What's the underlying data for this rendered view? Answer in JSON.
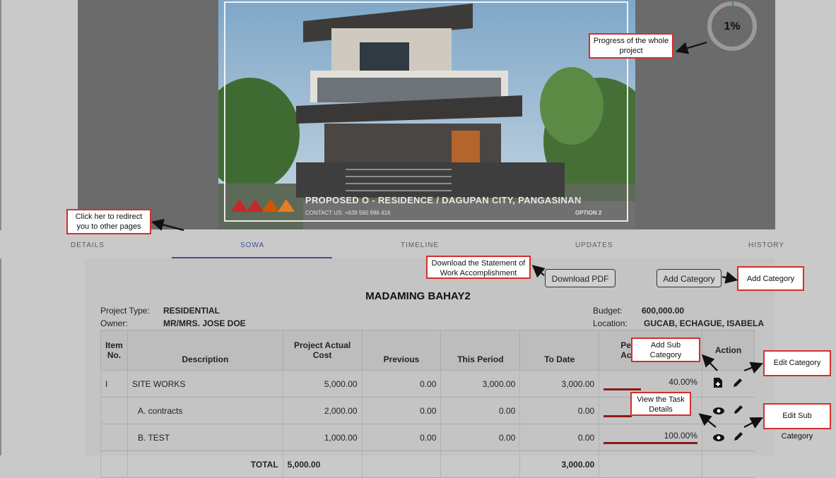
{
  "hero": {
    "caption": "PROPOSED O - RESIDENCE / DAGUPAN CITY, PANGASINAN",
    "contact": "CONTACT US: +639 560 996 416",
    "option": "OPTION 2"
  },
  "progress": {
    "label": "1%",
    "value": 0.01
  },
  "tabs": [
    {
      "label": "DETAILS"
    },
    {
      "label": "SOWA"
    },
    {
      "label": "TIMELINE"
    },
    {
      "label": "UPDATES"
    },
    {
      "label": "HISTORY"
    }
  ],
  "buttons": {
    "download_pdf": "Download PDF",
    "add_category": "Add Category"
  },
  "project": {
    "name": "MADAMING BAHAY2",
    "type_label": "Project Type:",
    "type_value": "RESIDENTIAL",
    "owner_label": "Owner:",
    "owner_value": "MR/MRS. JOSE DOE",
    "budget_label": "Budget:",
    "budget_value": "600,000.00",
    "location_label": "Location:",
    "location_value": "GUCAB, ECHAGUE, ISABELA"
  },
  "table": {
    "headers": {
      "item_no_1": "Item",
      "item_no_2": "No.",
      "description": "Description",
      "cost_1": "Project Actual",
      "cost_2": "Cost",
      "previous": "Previous",
      "this_period": "This Period",
      "to_date": "To Date",
      "percent_1": "Pe",
      "percent_2": "Acc",
      "action": "Action"
    },
    "rows": [
      {
        "item": "I",
        "description": "SITE WORKS",
        "cost": "5,000.00",
        "previous": "0.00",
        "this_period": "3,000.00",
        "to_date": "3,000.00",
        "percent": "40.00%",
        "fill": 0.4
      },
      {
        "item": "",
        "description": "A. contracts",
        "cost": "2,000.00",
        "previous": "0.00",
        "this_period": "0.00",
        "to_date": "0.00",
        "percent": "",
        "fill": 0.3
      },
      {
        "item": "",
        "description": "B. TEST",
        "cost": "1,000.00",
        "previous": "0.00",
        "this_period": "0.00",
        "to_date": "0.00",
        "percent": "100.00%",
        "fill": 1.0
      }
    ],
    "total": {
      "label": "TOTAL",
      "cost": "5,000.00",
      "to_date": "3,000.00"
    }
  },
  "annotations": {
    "redirect": "Click her to redirect you to other pages",
    "progress": "Progress of the whole project",
    "download": "Download the Statement of Work Accomplishment",
    "add_category": "Add Category",
    "add_sub_category": "Add Sub Category",
    "edit_category": "Edit Category",
    "view_task": "View the Task Details",
    "edit_sub_category": "Edit Sub Category"
  },
  "colors": {
    "tab_underline": "#3f4fa0",
    "progress_bar": "#8b1a1a",
    "annotation_border": "#d32f2f"
  }
}
